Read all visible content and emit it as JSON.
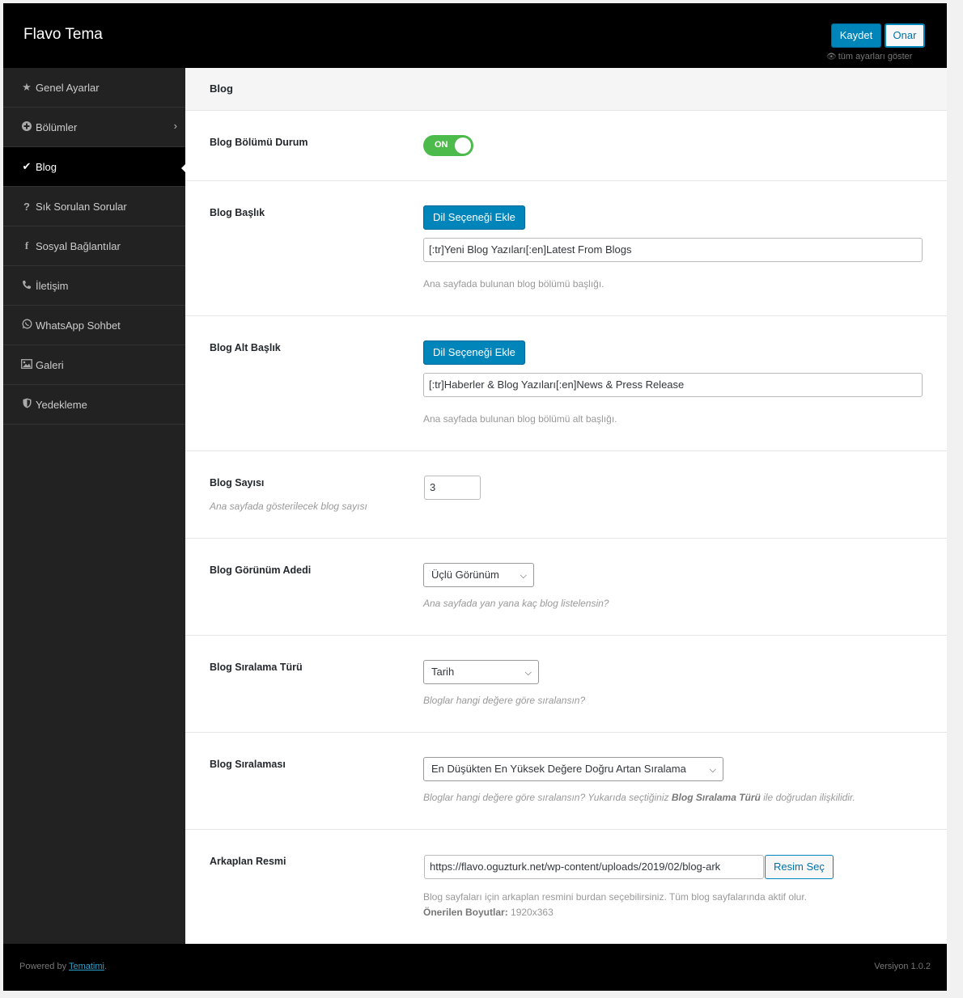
{
  "header": {
    "title": "Flavo Tema",
    "save_label": "Kaydet",
    "reset_label": "Onar",
    "show_all_label": "tüm ayarları göster"
  },
  "sidebar": {
    "items": [
      {
        "label": "Genel Ayarlar",
        "icon": "star-icon"
      },
      {
        "label": "Bölümler",
        "icon": "plus-circle-icon",
        "has_submenu": true
      },
      {
        "label": "Blog",
        "icon": "check-icon",
        "active": true
      },
      {
        "label": "Sık Sorulan Sorular",
        "icon": "question-icon"
      },
      {
        "label": "Sosyal Bağlantılar",
        "icon": "facebook-icon"
      },
      {
        "label": "İletişim",
        "icon": "phone-icon"
      },
      {
        "label": "WhatsApp Sohbet",
        "icon": "whatsapp-icon"
      },
      {
        "label": "Galeri",
        "icon": "image-icon"
      },
      {
        "label": "Yedekleme",
        "icon": "shield-icon"
      }
    ]
  },
  "section": {
    "title": "Blog"
  },
  "fields": {
    "status": {
      "label": "Blog Bölümü Durum",
      "toggle": "ON"
    },
    "title": {
      "label": "Blog Başlık",
      "button": "Dil Seçeneği Ekle",
      "value": "[:tr]Yeni Blog Yazıları[:en]Latest From Blogs",
      "help": "Ana sayfada bulunan blog bölümü başlığı."
    },
    "subtitle": {
      "label": "Blog Alt Başlık",
      "button": "Dil Seçeneği Ekle",
      "value": "[:tr]Haberler & Blog Yazıları[:en]News & Press Release",
      "help": "Ana sayfada bulunan blog bölümü alt başlığı."
    },
    "count": {
      "label": "Blog Sayısı",
      "sub": "Ana sayfada gösterilecek blog sayısı",
      "value": "3"
    },
    "view": {
      "label": "Blog Görünüm Adedi",
      "selected": "Üçlü Görünüm",
      "help": "Ana sayfada yan yana kaç blog listelensin?"
    },
    "sort_type": {
      "label": "Blog Sıralama Türü",
      "selected": "Tarih",
      "help": "Bloglar hangi değere göre sıralansın?"
    },
    "sort_order": {
      "label": "Blog Sıralaması",
      "selected": "En Düşükten En Yüksek Değere Doğru Artan Sıralama",
      "help_prefix": "Bloglar hangi değere göre sıralansın? Yukarıda seçtiğiniz ",
      "help_bold": "Blog Sıralama Türü",
      "help_suffix": " ile doğrudan ilişkilidir."
    },
    "background": {
      "label": "Arkaplan Resmi",
      "value": "https://flavo.oguzturk.net/wp-content/uploads/2019/02/blog-ark",
      "button": "Resim Seç",
      "help": "Blog sayfaları için arkaplan resmini burdan seçebilirsiniz. Tüm blog sayfalarında aktif olur.",
      "sizes_label": "Önerilen Boyutlar:",
      "sizes_value": "1920x363"
    }
  },
  "footer": {
    "powered_prefix": "Powered by ",
    "powered_link": "Tematimi",
    "powered_suffix": ".",
    "version": "Versiyon 1.0.2"
  },
  "colors": {
    "accent": "#0085ba",
    "toggle_on": "#4cbb4c",
    "sidebar_bg": "#222222",
    "topbar_bg": "#000000"
  }
}
